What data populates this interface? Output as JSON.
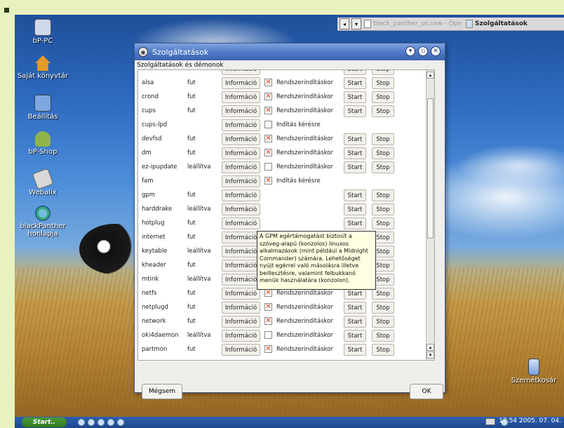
{
  "desktop": {
    "icons": [
      {
        "label": "bP-PC",
        "name": "bp-pc"
      },
      {
        "label": "Saját könyvtár",
        "name": "home"
      },
      {
        "label": "Beállítás",
        "name": "settings"
      },
      {
        "label": "bP-Shop",
        "name": "shop"
      },
      {
        "label": "Webalix",
        "name": "webalix"
      },
      {
        "label": "blackPanther honlapja",
        "name": "homepage"
      },
      {
        "label": "Szemétkosár",
        "name": "trash"
      }
    ]
  },
  "top_panel": {
    "task1": "black_panther_os.sxw - Ope",
    "task2": "Szolgáltatások"
  },
  "window": {
    "title": "Szolgáltatások",
    "subtitle": "Szolgáltatások és démonok",
    "info_label": "Információ",
    "start_label": "Start",
    "stop_label": "Stop",
    "cancel_label": "Mégsem",
    "ok_label": "OK",
    "services": [
      {
        "name": "alsa",
        "state": "fut",
        "checked": true,
        "label": "Rendszerindításkor",
        "buttons": true
      },
      {
        "name": "crond",
        "state": "fut",
        "checked": true,
        "label": "Rendszerindításkor",
        "buttons": true
      },
      {
        "name": "cups",
        "state": "fut",
        "checked": true,
        "label": "Rendszerindításkor",
        "buttons": true
      },
      {
        "name": "cups-lpd",
        "state": "",
        "checked": false,
        "label": "Indítás kérésre",
        "buttons": false
      },
      {
        "name": "devfsd",
        "state": "fut",
        "checked": true,
        "label": "Rendszerindításkor",
        "buttons": true
      },
      {
        "name": "dm",
        "state": "fut",
        "checked": true,
        "label": "Rendszerindításkor",
        "buttons": true
      },
      {
        "name": "ez-ipupdate",
        "state": "leállítva",
        "checked": false,
        "label": "Rendszerindításkor",
        "buttons": true
      },
      {
        "name": "fam",
        "state": "",
        "checked": true,
        "label": "Indítás kérésre",
        "buttons": false
      },
      {
        "name": "gpm",
        "state": "fut",
        "checked": false,
        "label": "",
        "buttons": true
      },
      {
        "name": "harddrake",
        "state": "leállítva",
        "checked": false,
        "label": "",
        "buttons": true
      },
      {
        "name": "hotplug",
        "state": "fut",
        "checked": false,
        "label": "",
        "buttons": true
      },
      {
        "name": "internet",
        "state": "fut",
        "checked": false,
        "label": "",
        "buttons": true
      },
      {
        "name": "keytable",
        "state": "leállítva",
        "checked": false,
        "label": "",
        "buttons": true
      },
      {
        "name": "kheader",
        "state": "fut",
        "checked": true,
        "label": "Rendszerindításkor",
        "buttons": true
      },
      {
        "name": "mtink",
        "state": "leállítva",
        "checked": false,
        "label": "Rendszerindításkor",
        "buttons": true
      },
      {
        "name": "netfs",
        "state": "fut",
        "checked": true,
        "label": "Rendszerindításkor",
        "buttons": true
      },
      {
        "name": "netplugd",
        "state": "fut",
        "checked": true,
        "label": "Rendszerindításkor",
        "buttons": true
      },
      {
        "name": "network",
        "state": "fut",
        "checked": true,
        "label": "Rendszerindításkor",
        "buttons": true
      },
      {
        "name": "oki4daemon",
        "state": "leállítva",
        "checked": false,
        "label": "Rendszerindításkor",
        "buttons": true
      },
      {
        "name": "partmon",
        "state": "fut",
        "checked": true,
        "label": "Rendszerindításkor",
        "buttons": true
      }
    ],
    "tooltip": "A GPM egértámogatást biztosít a szöveg-alapú (konzolos) linuxos alkalmazások (mint például a Midnight Commander) számára. Lehetőséget nyújt egérrel való másolásra illetve beillesztésre, valamint felbukkanó menük használatára (konzolon)."
  },
  "taskbar": {
    "start_label": "Start..",
    "clock": "17:54 2005. 07. 04."
  },
  "colors": {
    "title_blue": "#4d77c4",
    "check_mark": "#d23c10"
  }
}
